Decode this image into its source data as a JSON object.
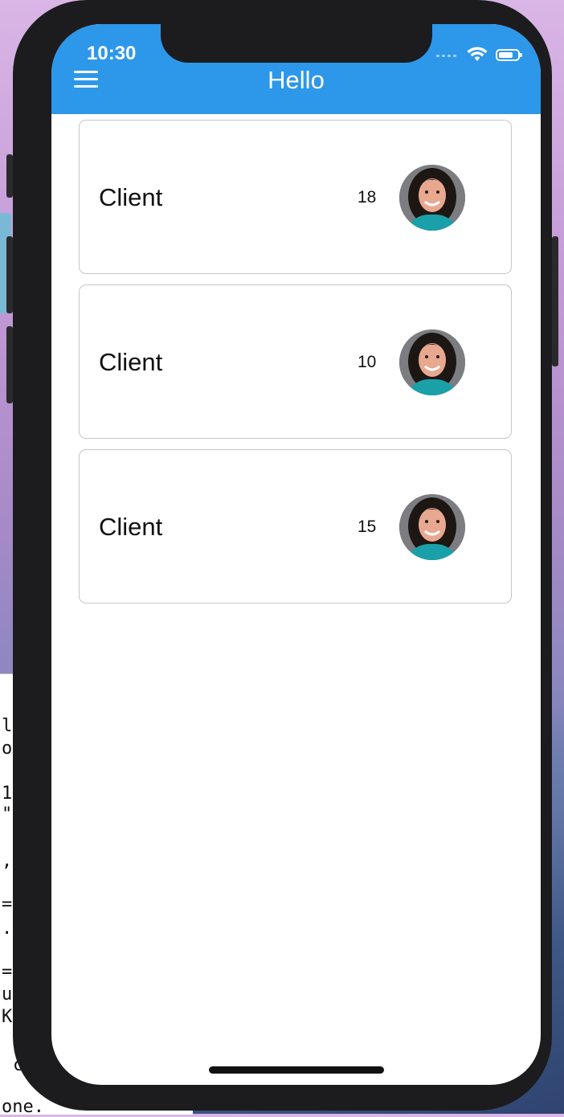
{
  "status_bar": {
    "time": "10:30",
    "battery_level": 0.75
  },
  "navbar": {
    "title": "Hello"
  },
  "clients": [
    {
      "name": "Client",
      "count": "18"
    },
    {
      "name": "Client",
      "count": "10"
    },
    {
      "name": "Client",
      "count": "15"
    }
  ],
  "icons": {
    "menu": "hamburger-menu-icon",
    "wifi": "wifi-icon",
    "battery": "battery-icon",
    "signal": "cellular-signal-icon"
  },
  "colors": {
    "navbar": "#2d97ea",
    "card_border": "#c6c6c8"
  },
  "background": {
    "terminal_lines": [
      "l",
      "o",
      "1",
      "\"",
      ",",
      "=",
      ".",
      "=",
      "u",
      "K",
      "c",
      "one."
    ]
  }
}
